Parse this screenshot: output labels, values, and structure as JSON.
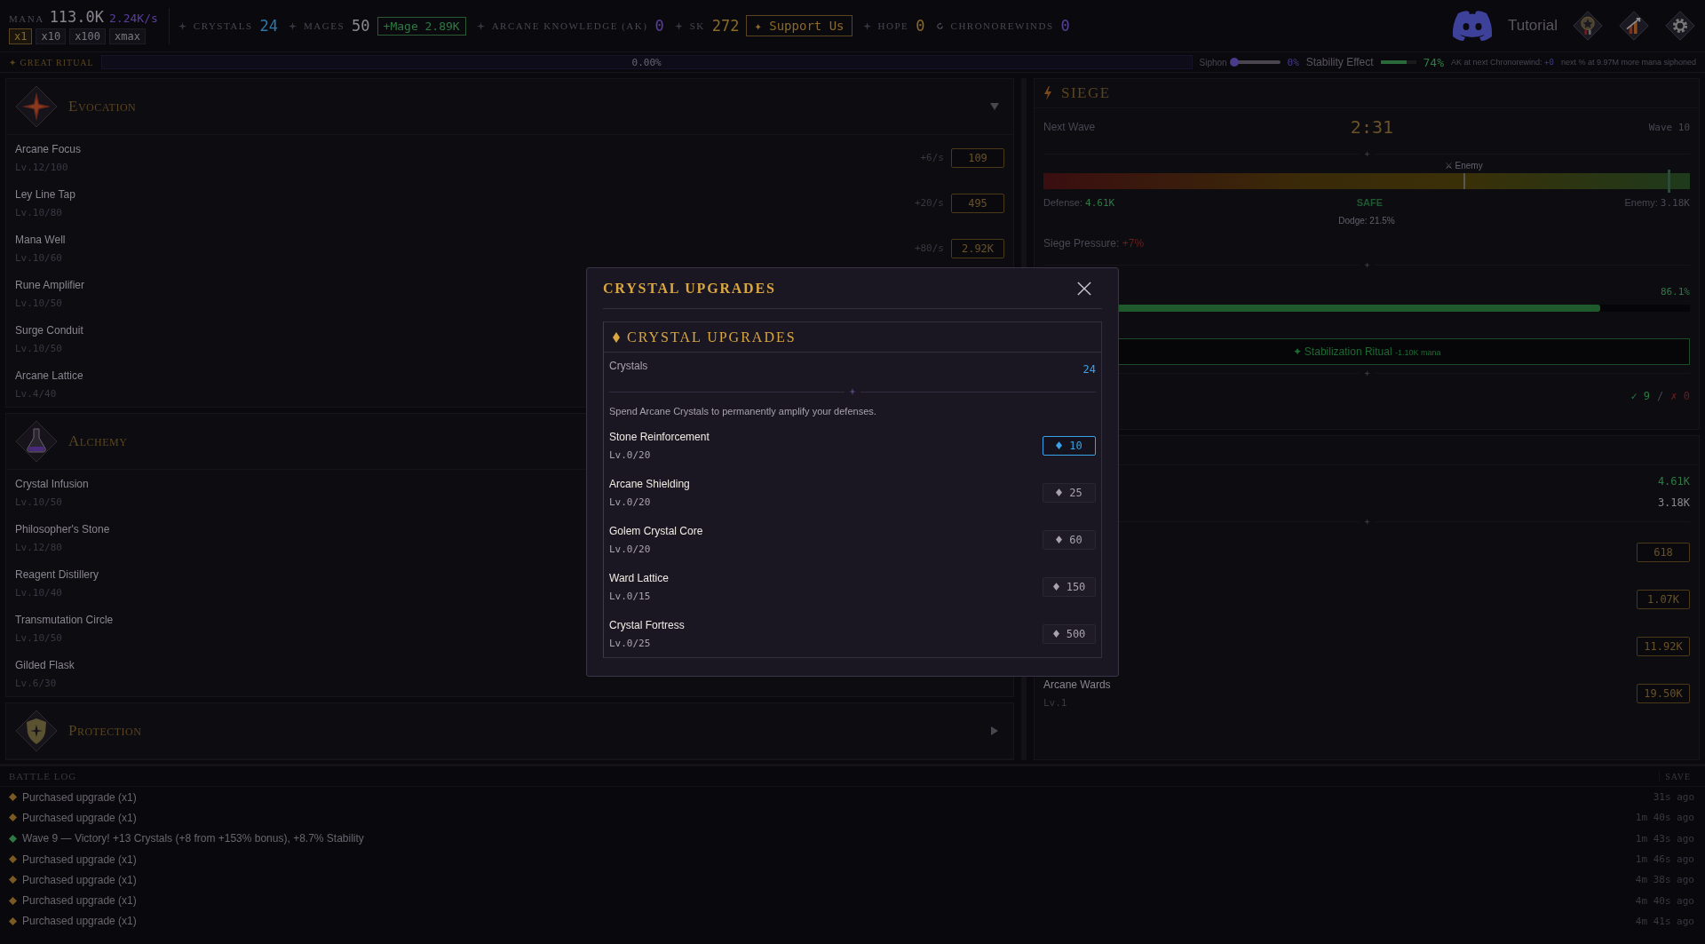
{
  "top_bar": {
    "mana": {
      "label": "MANA",
      "value": "113.0K",
      "rate": "2.24K/s",
      "multipliers": [
        {
          "label": "x1",
          "selected": true
        },
        {
          "label": "x10",
          "selected": false
        },
        {
          "label": "x100",
          "selected": false
        },
        {
          "label": "xmax",
          "selected": false
        }
      ]
    },
    "stats": [
      {
        "kind": "stat",
        "label": "CRYSTALS",
        "value": "24",
        "color": "#2f78aa"
      },
      {
        "kind": "stat",
        "label": "MAGES",
        "value": "50",
        "color": "#8a8a8a",
        "button": {
          "label": "+Mage 2.89K",
          "kind": "buy"
        }
      },
      {
        "kind": "stat",
        "label": "ARCANE KNOWLEDGE (AK)",
        "value": "0",
        "color": "#5a3f9a"
      },
      {
        "kind": "stat",
        "label": "SK",
        "value": "272",
        "color": "#8a6a2a",
        "button": {
          "label": "✦ Support Us",
          "kind": "support"
        }
      },
      {
        "kind": "stat",
        "label": "HOPE",
        "value": "0",
        "color": "#8a6a2a"
      },
      {
        "kind": "rewind",
        "label": "CHRONOREWINDS",
        "value": "0",
        "color": "#5a3f9a"
      }
    ],
    "tutorial": "Tutorial"
  },
  "ritual_bar": {
    "label": "✦ GREAT RITUAL",
    "progress": {
      "level": 0,
      "reading": "0.00%"
    },
    "siphon": {
      "label": "Siphon",
      "level": 0,
      "reading": "0%"
    },
    "stability": {
      "label": "Stability Effect",
      "level": 0.74,
      "reading": "74%"
    },
    "ak_note": {
      "label": "AK at next Chronorewind:",
      "value": "+0"
    },
    "next_note": "next % at 9.97M more mana siphoned"
  },
  "sections": [
    {
      "title": "Evocation",
      "kind": "evocation",
      "expanded": true,
      "show_caret": true,
      "items": [
        {
          "name": "Arcane Focus",
          "lv": "Lv.12/100",
          "rate": "+6/s",
          "cost": "109"
        },
        {
          "name": "Ley Line Tap",
          "lv": "Lv.10/80",
          "rate": "+20/s",
          "cost": "495"
        },
        {
          "name": "Mana Well",
          "lv": "Lv.10/60",
          "rate": "+80/s",
          "cost": "2.92K"
        },
        {
          "name": "Rune Amplifier",
          "lv": "Lv.10/50"
        },
        {
          "name": "Surge Conduit",
          "lv": "Lv.10/50"
        },
        {
          "name": "Arcane Lattice",
          "lv": "Lv.4/40"
        }
      ]
    },
    {
      "title": "Alchemy",
      "kind": "alchemy",
      "expanded": true,
      "show_caret": false,
      "items": [
        {
          "name": "Crystal Infusion",
          "lv": "Lv.10/50"
        },
        {
          "name": "Philosopher's Stone",
          "lv": "Lv.12/80"
        },
        {
          "name": "Reagent Distillery",
          "lv": "Lv.10/40"
        },
        {
          "name": "Transmutation Circle",
          "lv": "Lv.10/50"
        },
        {
          "name": "Gilded Flask",
          "lv": "Lv.6/30"
        }
      ]
    },
    {
      "title": "Protection",
      "kind": "protection",
      "expanded": false,
      "show_caret": true
    }
  ],
  "siege": {
    "title": "SIEGE",
    "next_wave_label": "Next Wave",
    "timer": "2:31",
    "wave": "Wave 10",
    "enemy_marker": {
      "label": "⚔ Enemy",
      "level": 0.65
    },
    "defense_marker": {
      "level": 0.965
    },
    "defense": {
      "label": "Defense:",
      "value": "4.61K"
    },
    "status": "SAFE",
    "enemy": {
      "label": "Enemy:",
      "value": "3.18K"
    },
    "dodge": "Dodge: 21.5%",
    "pressure": {
      "label": "Siege Pressure:",
      "value": "+7%"
    },
    "stability": {
      "reading": "86.1%",
      "level": 0.861
    },
    "ritual_button": {
      "label": "✦ Stabilization Ritual",
      "cost": "-1.10K mana"
    },
    "record": {
      "wins": "✓ 9",
      "sep": "/",
      "losses": "✗ 0"
    }
  },
  "defense_panel": {
    "stats": [
      {
        "value": "4.61K",
        "color": "#2f7a44"
      },
      {
        "value": "3.18K",
        "color": "#8a8a8a"
      }
    ],
    "upgrades": [
      {
        "cost": "618"
      },
      {
        "cost": "1.07K"
      },
      {
        "cost": "11.92K"
      },
      {
        "name": "Arcane Wards",
        "lv": "Lv.1",
        "cost": "19.50K"
      }
    ]
  },
  "battle_log": {
    "title": "BATTLE LOG",
    "save": "SAVE",
    "entries": [
      {
        "text": "Purchased upgrade (x1)",
        "time": "31s ago",
        "color": "#7a5a22"
      },
      {
        "text": "Purchased upgrade (x1)",
        "time": "1m 40s ago",
        "color": "#7a5a22"
      },
      {
        "text": "Wave 9 — Victory! +13 Crystals (+8 from +153% bonus), +8.7% Stability",
        "time": "1m 43s ago",
        "color": "#2f7a44"
      },
      {
        "text": "Purchased upgrade (x1)",
        "time": "1m 46s ago",
        "color": "#7a5a22"
      },
      {
        "text": "Purchased upgrade (x1)",
        "time": "4m 38s ago",
        "color": "#7a5a22"
      },
      {
        "text": "Purchased upgrade (x1)",
        "time": "4m 40s ago",
        "color": "#7a5a22"
      },
      {
        "text": "Purchased upgrade (x1)",
        "time": "4m 41s ago",
        "color": "#7a5a22"
      }
    ]
  },
  "modal": {
    "title": "CRYSTAL UPGRADES",
    "section": "CRYSTAL UPGRADES",
    "balance": {
      "label": "Crystals",
      "value": "24"
    },
    "description": "Spend Arcane Crystals to permanently amplify your defenses.",
    "upgrades": [
      {
        "name": "Stone Reinforcement",
        "lv": "Lv.0/20",
        "cost": "10",
        "affordable": true
      },
      {
        "name": "Arcane Shielding",
        "lv": "Lv.0/20",
        "cost": "25",
        "affordable": false
      },
      {
        "name": "Golem Crystal Core",
        "lv": "Lv.0/20",
        "cost": "60",
        "affordable": false
      },
      {
        "name": "Ward Lattice",
        "lv": "Lv.0/15",
        "cost": "150",
        "affordable": false
      },
      {
        "name": "Crystal Fortress",
        "lv": "Lv.0/25",
        "cost": "500",
        "affordable": false
      }
    ]
  }
}
